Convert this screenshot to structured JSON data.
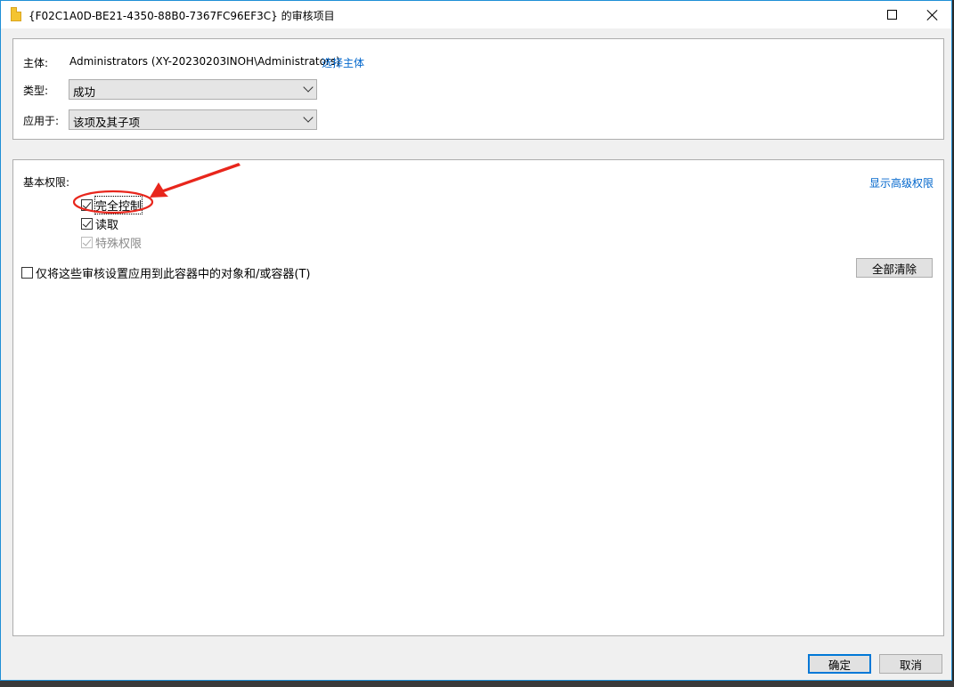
{
  "window": {
    "title": "{F02C1A0D-BE21-4350-88B0-7367FC96EF3C} 的审核项目"
  },
  "principal": {
    "label": "主体:",
    "value": "Administrators (XY-20230203INOH\\Administrators)",
    "select_link": "选择主体"
  },
  "type_field": {
    "label": "类型:",
    "value": "成功"
  },
  "apply_field": {
    "label": "应用于:",
    "value": "该项及其子项"
  },
  "permissions": {
    "heading": "基本权限:",
    "show_advanced_link": "显示高级权限",
    "items": [
      {
        "label": "完全控制",
        "checked": true,
        "enabled": true
      },
      {
        "label": "读取",
        "checked": true,
        "enabled": true
      },
      {
        "label": "特殊权限",
        "checked": true,
        "enabled": false
      }
    ],
    "apply_only_label": "仅将这些审核设置应用到此容器中的对象和/或容器(T)",
    "apply_only_checked": false,
    "clear_all_label": "全部清除"
  },
  "footer": {
    "ok_label": "确定",
    "cancel_label": "取消"
  },
  "colors": {
    "accent": "#0078d7",
    "link": "#0066cc",
    "annotation": "#e8261c"
  }
}
